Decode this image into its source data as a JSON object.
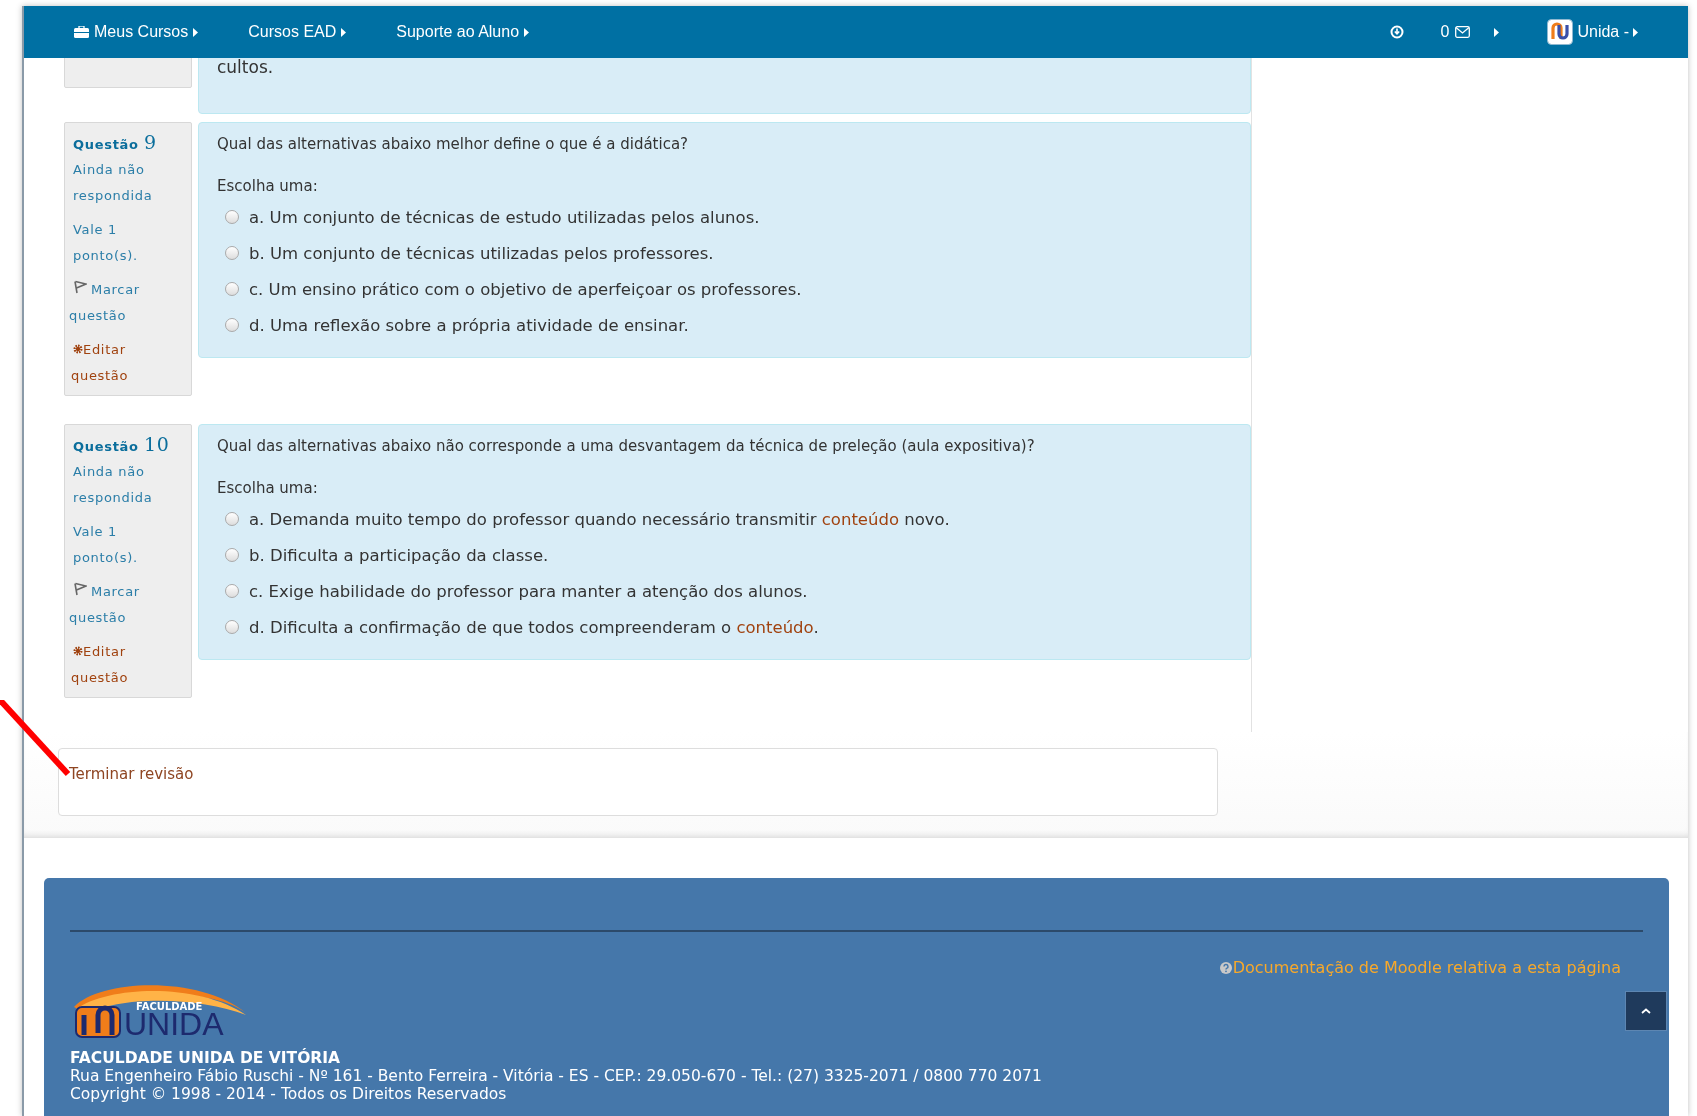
{
  "navbar": {
    "items": [
      {
        "label": "Meus Cursos"
      },
      {
        "label": "Cursos EAD"
      },
      {
        "label": "Suporte ao Aluno"
      }
    ],
    "message_count": "0",
    "user_name": "Unida -"
  },
  "previous_question_tail": "cultos.",
  "questions": [
    {
      "label": "Questão",
      "number": "9",
      "status": "Ainda não respondida",
      "points": "Vale 1 ponto(s).",
      "flag_label": "Marcar questão",
      "edit_label": "Editar questão",
      "text": "Qual das alternativas abaixo melhor define o que é a didática?",
      "prompt": "Escolha uma:",
      "options": [
        {
          "selected": false,
          "parts": [
            {
              "kind": "text",
              "text": "a. Um conjunto de técnicas de estudo utilizadas pelos alunos."
            }
          ]
        },
        {
          "selected": false,
          "parts": [
            {
              "kind": "text",
              "text": "b. Um conjunto de técnicas utilizadas pelos professores."
            }
          ]
        },
        {
          "selected": false,
          "parts": [
            {
              "kind": "text",
              "text": "c. Um ensino prático com o objetivo de aperfeiçoar os professores."
            }
          ]
        },
        {
          "selected": false,
          "parts": [
            {
              "kind": "text",
              "text": "d. Uma reflexão sobre a própria atividade de ensinar."
            }
          ]
        }
      ]
    },
    {
      "label": "Questão",
      "number": "10",
      "status": "Ainda não respondida",
      "points": "Vale 1 ponto(s).",
      "flag_label": "Marcar questão",
      "edit_label": "Editar questão",
      "text": "Qual das alternativas abaixo não corresponde a uma desvantagem da técnica de preleção (aula expositiva)?",
      "prompt": "Escolha uma:",
      "options": [
        {
          "selected": false,
          "parts": [
            {
              "kind": "text",
              "text": "a. Demanda muito tempo do professor quando necessário transmitir "
            },
            {
              "kind": "link",
              "text": "conteúdo"
            },
            {
              "kind": "text",
              "text": " novo."
            }
          ]
        },
        {
          "selected": false,
          "parts": [
            {
              "kind": "text",
              "text": "b. Dificulta a participação da classe."
            }
          ]
        },
        {
          "selected": false,
          "parts": [
            {
              "kind": "text",
              "text": "c. Exige habilidade do professor para manter a atenção dos alunos."
            }
          ]
        },
        {
          "selected": false,
          "parts": [
            {
              "kind": "text",
              "text": "d. Dificulta a confirmação de que todos compreenderam o "
            },
            {
              "kind": "link",
              "text": "conteúdo"
            },
            {
              "kind": "text",
              "text": "."
            }
          ]
        }
      ]
    }
  ],
  "finish_link": "Terminar revisão",
  "footer": {
    "doc_link": "Documentação de Moodle relativa a esta página",
    "logo_top": "FACULDADE",
    "logo_main": "UNIDA",
    "name": "FACULDADE UNIDA DE VITÓRIA",
    "address": "Rua Engenheiro Fábio Ruschi - Nº 161 - Bento Ferreira - Vitória - ES - CEP.: 29.050-670 - Tel.: (27) 3325-2071 / 0800 770 2071",
    "copyright": "Copyright © 1998 - 2014 - Todos os Direitos Reservados"
  }
}
